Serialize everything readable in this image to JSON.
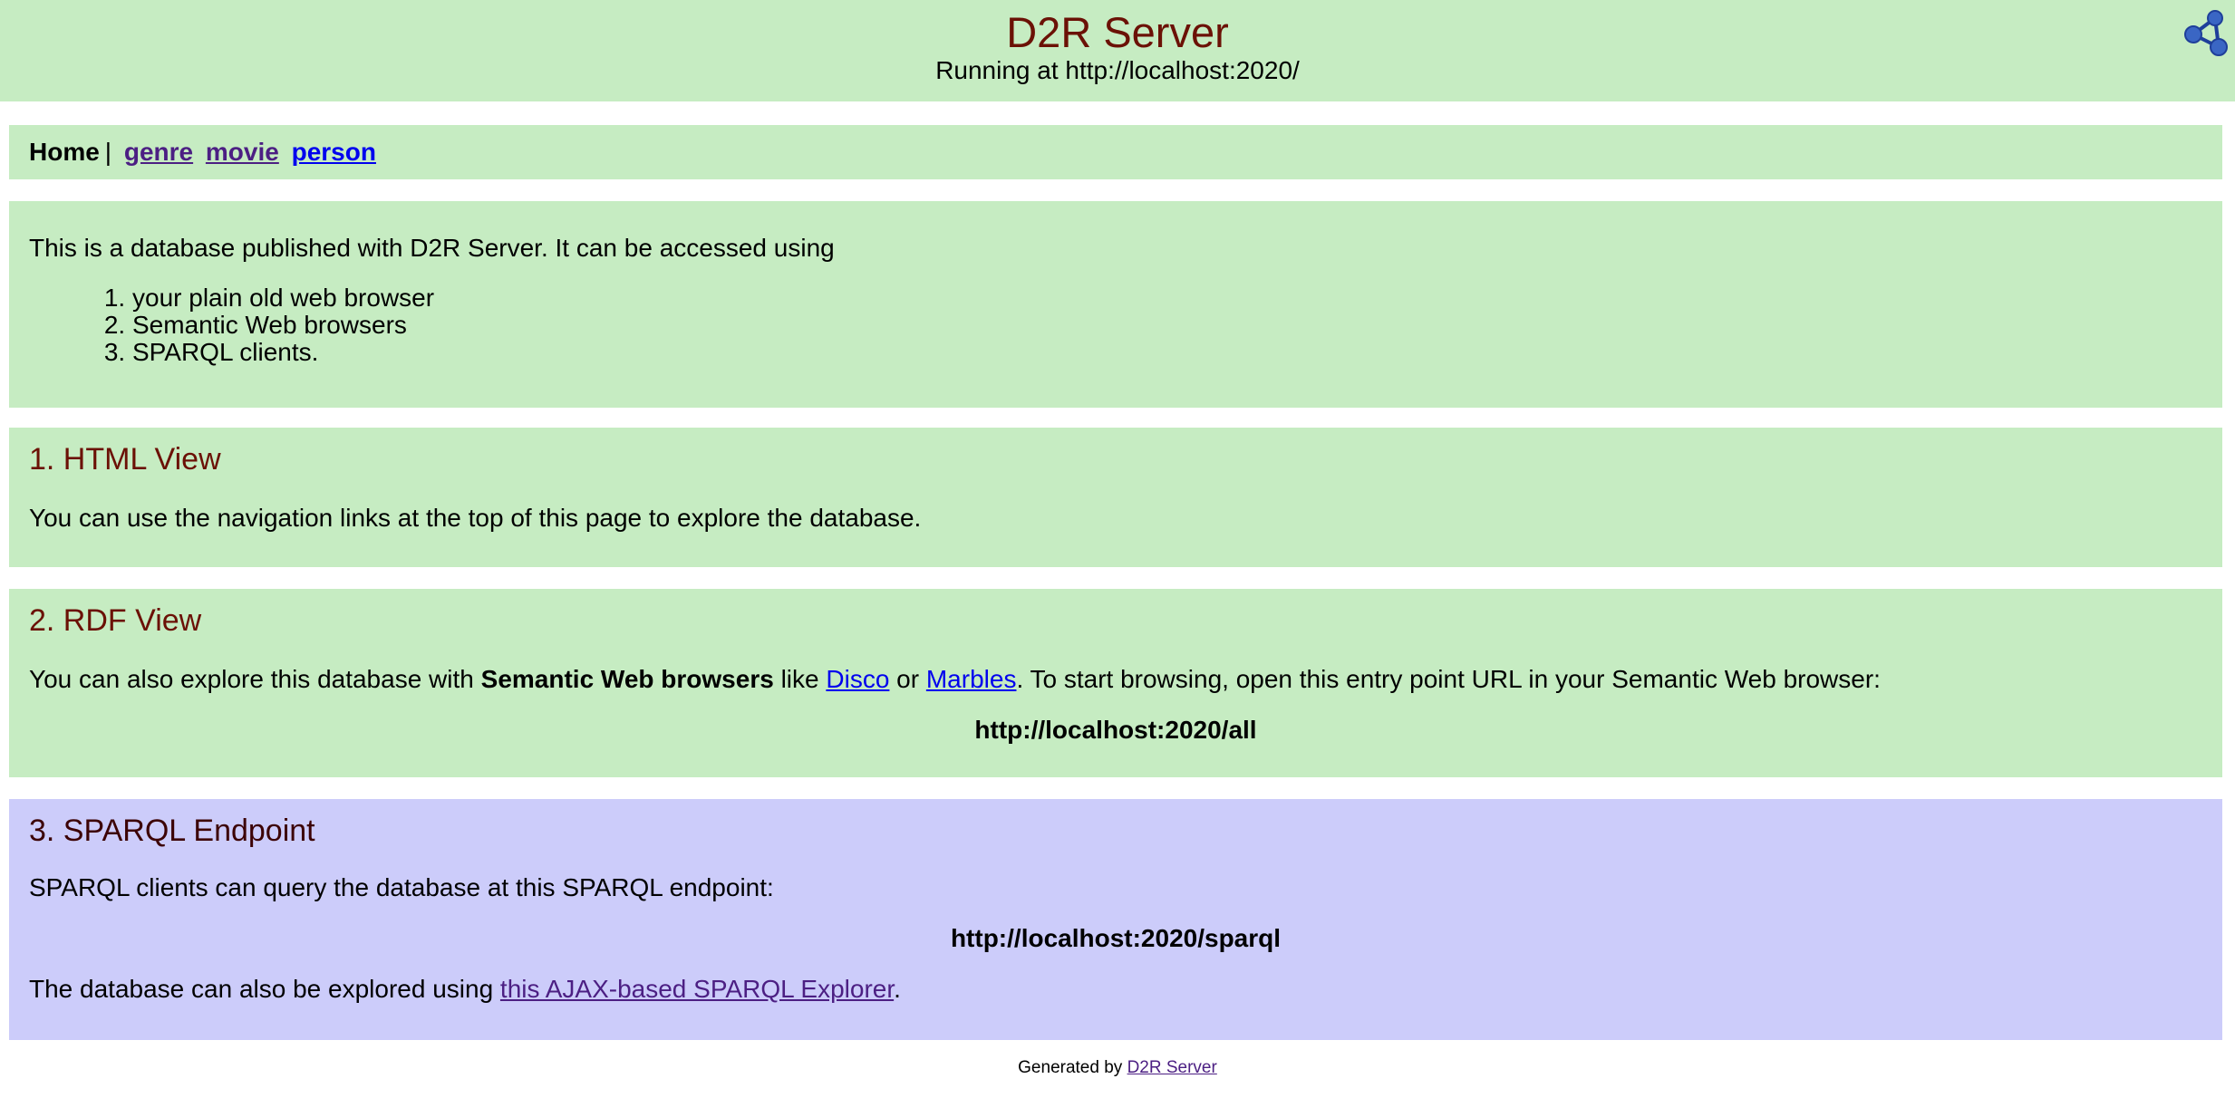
{
  "header": {
    "title": "D2R Server",
    "subtitle": "Running at http://localhost:2020/",
    "logo_icon": "rdf-graph-logo-icon"
  },
  "nav": {
    "home": "Home",
    "separator": "|",
    "links": [
      "genre",
      "movie",
      "person"
    ]
  },
  "intro": {
    "text": "This is a database published with D2R Server. It can be accessed using",
    "items": [
      "your plain old web browser",
      "Semantic Web browsers",
      "SPARQL clients."
    ]
  },
  "html_view": {
    "heading": "1. HTML View",
    "text": "You can use the navigation links at the top of this page to explore the database."
  },
  "rdf_view": {
    "heading": "2. RDF View",
    "text_1": "You can also explore this database with ",
    "text_bold": "Semantic Web browsers",
    "text_2": " like ",
    "link_disco": "Disco",
    "text_3": " or ",
    "link_marbles": "Marbles",
    "text_4": ". To start browsing, open this entry point URL in your Semantic Web browser:",
    "entry_url": "http://localhost:2020/all"
  },
  "sparql": {
    "heading": "3. SPARQL Endpoint",
    "text": "SPARQL clients can query the database at this SPARQL endpoint:",
    "endpoint_url": "http://localhost:2020/sparql",
    "explorer_text_1": "The database can also be explored using ",
    "explorer_link": "this AJAX-based SPARQL Explorer",
    "explorer_text_2": "."
  },
  "footer": {
    "text": "Generated by ",
    "link": "D2R Server"
  },
  "colors": {
    "panel_green": "#c6ecc2",
    "panel_blue": "#ccccfa",
    "heading_red": "#6b1106",
    "link_blue": "#0000ee",
    "link_visited": "#4c1f83"
  }
}
